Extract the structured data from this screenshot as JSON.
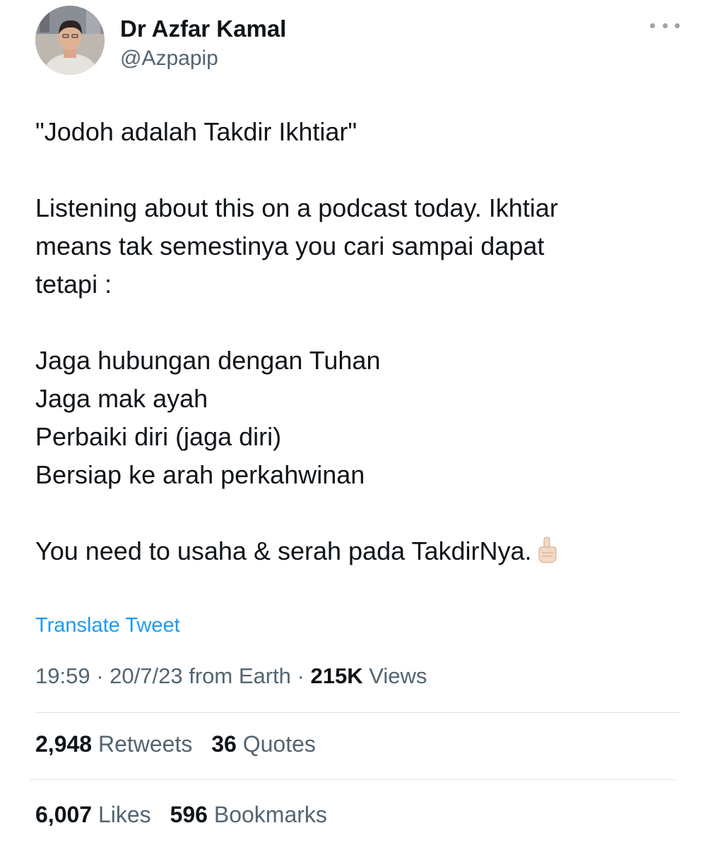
{
  "author": {
    "name": "Dr Azfar Kamal",
    "handle": "@Azpapip"
  },
  "tweet": {
    "lines": [
      "\"Jodoh adalah Takdir Ikhtiar\"",
      "",
      "Listening about this on a podcast today. Ikhtiar",
      "means tak semestinya you cari sampai dapat",
      "tetapi :",
      "",
      "Jaga hubungan dengan Tuhan",
      "Jaga mak ayah",
      "Perbaiki diri (jaga diri)",
      "Bersiap ke arah perkahwinan",
      "",
      "You need to usaha & serah pada TakdirNya."
    ],
    "emoji": "pointing-up-icon"
  },
  "translate_label": "Translate Tweet",
  "meta": {
    "time": "19:59",
    "separator": "·",
    "date": "20/7/23",
    "from": "from Earth",
    "views_count": "215K",
    "views_label": "Views"
  },
  "stats": {
    "retweets_count": "2,948",
    "retweets_label": "Retweets",
    "quotes_count": "36",
    "quotes_label": "Quotes",
    "likes_count": "6,007",
    "likes_label": "Likes",
    "bookmarks_count": "596",
    "bookmarks_label": "Bookmarks"
  },
  "colors": {
    "link": "#1d9bf0",
    "muted": "#536471",
    "text": "#0f1419",
    "divider": "#dfe3e6"
  }
}
